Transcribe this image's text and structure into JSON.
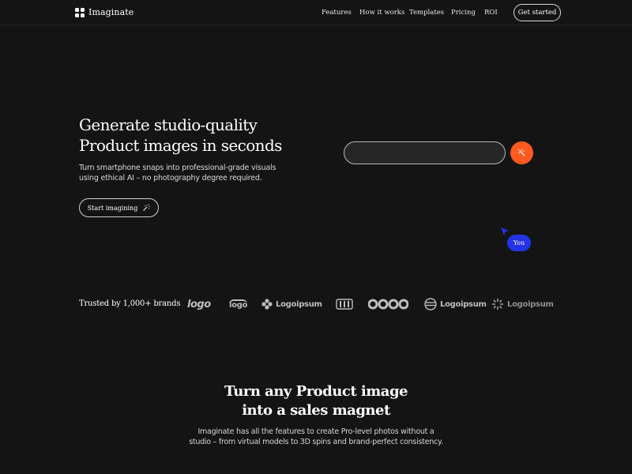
{
  "brand": {
    "name": "Imaginate",
    "icon": "four-squares-icon"
  },
  "nav": {
    "links": [
      "Features",
      "How it works",
      "Templates",
      "Pricing",
      "ROI"
    ],
    "cta": "Get started"
  },
  "hero": {
    "title_line1": "Generate studio-quality",
    "title_line2": "Product images in seconds",
    "subtitle_line1": "Turn smartphone snaps into professional-grade visuals",
    "subtitle_line2": "using ethical AI – no photography degree required.",
    "start_button": "Start imagining",
    "start_icon": "magic-wand-icon",
    "prompt_placeholder": "",
    "prompt_submit_icon": "magic-wand-icon",
    "cursor_label": "You"
  },
  "trusted": {
    "label": "Trusted by 1,000+ brands",
    "logos": [
      "logo",
      "logo",
      "Logoipsum",
      "",
      "",
      "Logoipsum",
      "Logoipsum"
    ]
  },
  "section2": {
    "title_line1": "Turn any Product image",
    "title_line2": "into a sales magnet",
    "subtitle_line1": "Imaginate has all the features to create Pro-level photos without a",
    "subtitle_line2": "studio – from virtual models to 3D spins and brand-perfect consistency."
  },
  "colors": {
    "background": "#141414",
    "accent_orange": "#ff5a1f",
    "cursor_blue": "#2334e6"
  }
}
